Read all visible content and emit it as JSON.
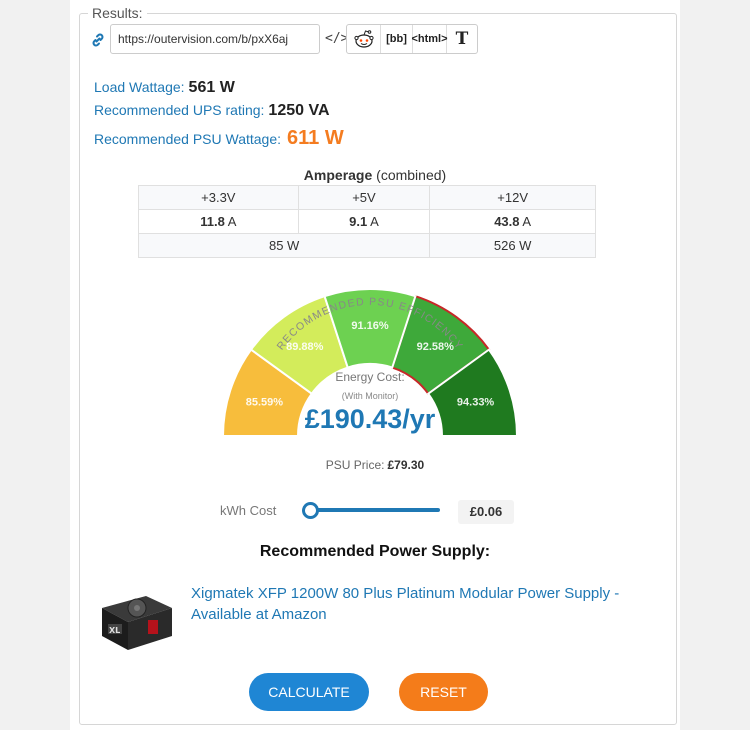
{
  "results_label": "Results:",
  "share": {
    "url": "https://outervision.com/b/pxX6aj",
    "embed_label": "</>",
    "buttons": [
      "[bb]",
      "<html>",
      "T"
    ]
  },
  "stats": {
    "load_label": "Load Wattage:",
    "load_value": "561 W",
    "ups_label": "Recommended UPS rating:",
    "ups_value": "1250 VA",
    "psu_label": "Recommended PSU Wattage:",
    "psu_value": "611 W"
  },
  "amperage": {
    "title": "Amperage",
    "subtitle": "(combined)",
    "rails": [
      "+3.3V",
      "+5V",
      "+12V"
    ],
    "amps": [
      "11.8",
      "9.1",
      "43.8"
    ],
    "amp_unit": "A",
    "watts": [
      "85 W",
      "526 W"
    ]
  },
  "gauge": {
    "arc_title": "RECOMMENDED PSU EFFICIENCY",
    "segments": [
      {
        "label": "85.59%",
        "color": "#f7bd3c"
      },
      {
        "label": "89.88%",
        "color": "#d3ec5b"
      },
      {
        "label": "91.16%",
        "color": "#6dd151"
      },
      {
        "label": "92.58%",
        "color": "#3ea93a"
      },
      {
        "label": "94.33%",
        "color": "#1f7a1f"
      }
    ],
    "highlighted_index": 3,
    "energy_label": "Energy Cost:",
    "energy_sub": "(With Monitor)",
    "energy_value": "£190.43/yr"
  },
  "psu_price": {
    "label": "PSU Price:",
    "value": "£79.30"
  },
  "kwh": {
    "label": "kWh Cost",
    "value": "£0.06",
    "slider_fraction": 0.0
  },
  "recommendation": {
    "title": "Recommended Power Supply:",
    "product": "Xigmatek XFP 1200W 80 Plus Platinum Modular Power Supply - Available at Amazon"
  },
  "buttons": {
    "calculate": "CALCULATE",
    "reset": "RESET"
  },
  "colors": {
    "link": "#1f78b4",
    "accent_orange": "#f47c20",
    "button_blue": "#1f86d4"
  }
}
